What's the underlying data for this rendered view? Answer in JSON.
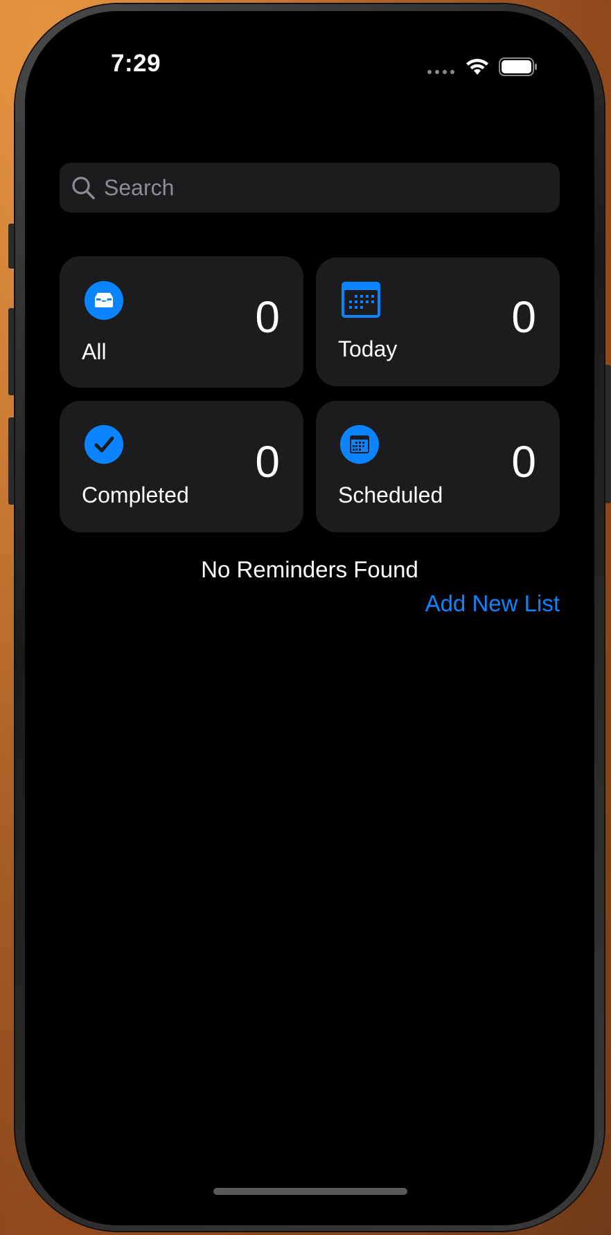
{
  "status_bar": {
    "time": "7:29"
  },
  "search": {
    "placeholder": "Search"
  },
  "tiles": [
    {
      "label": "All",
      "count": "0",
      "icon": "tray-icon"
    },
    {
      "label": "Today",
      "count": "0",
      "icon": "calendar-icon"
    },
    {
      "label": "Completed",
      "count": "0",
      "icon": "checkmark-icon"
    },
    {
      "label": "Scheduled",
      "count": "0",
      "icon": "calendar-badge-icon"
    }
  ],
  "empty_state": {
    "message": "No Reminders Found"
  },
  "actions": {
    "add_list_label": "Add New List"
  },
  "colors": {
    "accent": "#0a84ff",
    "tile_background": "#1c1c1e",
    "screen_background": "#000000"
  }
}
